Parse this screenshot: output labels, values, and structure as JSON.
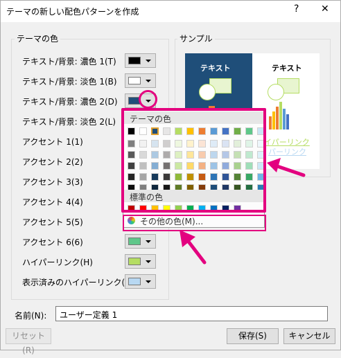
{
  "window": {
    "title": "テーマの新しい配色パターンを作成",
    "help_label": "?",
    "close_label": "✕"
  },
  "theme_colors": {
    "group_label": "テーマの色",
    "rows": [
      {
        "label": "テキスト/背景: 濃色 1(T)",
        "swatch": "#000000"
      },
      {
        "label": "テキスト/背景: 淡色 1(B)",
        "swatch": "#ffffff"
      },
      {
        "label": "テキスト/背景: 濃色 2(D)",
        "swatch": "#1f4e79"
      },
      {
        "label": "テキスト/背景: 淡色 2(L)",
        "swatch": ""
      },
      {
        "label": "アクセント 1(1)",
        "swatch": ""
      },
      {
        "label": "アクセント 2(2)",
        "swatch": ""
      },
      {
        "label": "アクセント 3(3)",
        "swatch": ""
      },
      {
        "label": "アクセント 4(4)",
        "swatch": ""
      },
      {
        "label": "アクセント 5(5)",
        "swatch": ""
      },
      {
        "label": "アクセント 6(6)",
        "swatch": "#5fc78a"
      },
      {
        "label": "ハイパーリンク(H)",
        "swatch": "#b5dd63"
      },
      {
        "label": "表示済みのハイパーリンク(F)",
        "swatch": "#b8d8f2"
      }
    ]
  },
  "sample": {
    "group_label": "サンプル",
    "dark_text": "テキスト",
    "light_text": "テキスト",
    "link1": "イパーリンク",
    "link2": "パーリンク",
    "colors": {
      "dark_bg": "#1f4e79",
      "light_bg": "#ffffff"
    }
  },
  "color_popup": {
    "theme_header": "テーマの色",
    "standard_header": "標準の色",
    "more_colors": "その他の色(M)...",
    "theme_top": [
      "#000000",
      "#ffffff",
      "#1f4e79",
      "#e7e6e6",
      "#b5dd63",
      "#ffc000",
      "#ed7d31",
      "#5b9bd5",
      "#4472c4",
      "#70ad47",
      "#5fc78a",
      "#c8e6f5"
    ],
    "theme_shades": [
      [
        "#7f7f7f",
        "#f2f2f2",
        "#d6e4f0",
        "#d0cece",
        "#eef7df",
        "#fff2cc",
        "#fbe4d5",
        "#deebf7",
        "#dae3f3",
        "#e2efda",
        "#dff4e7",
        "#eef7fc"
      ],
      [
        "#595959",
        "#d9d9d9",
        "#adc9e2",
        "#aeabab",
        "#ddf0c1",
        "#ffe699",
        "#f8cbad",
        "#bdd7ee",
        "#b4c7e7",
        "#c5e0b4",
        "#bfe9cf",
        "#ddf0fa"
      ],
      [
        "#404040",
        "#bfbfbf",
        "#84add3",
        "#757171",
        "#cbe8a2",
        "#ffd966",
        "#f4b183",
        "#9dc3e6",
        "#8faadc",
        "#a9d18e",
        "#9fdeb8",
        "#cce8f7"
      ],
      [
        "#262626",
        "#a6a6a6",
        "#173a5b",
        "#3a3838",
        "#8fb93a",
        "#bf9000",
        "#c55a11",
        "#2e75b6",
        "#2f5597",
        "#548235",
        "#38a865",
        "#6fb6e4"
      ],
      [
        "#0d0d0d",
        "#808080",
        "#0f273c",
        "#171616",
        "#5f7b27",
        "#806000",
        "#843c0c",
        "#1f4e79",
        "#203864",
        "#375623",
        "#256f43",
        "#2b7cb3"
      ]
    ],
    "standard": [
      "#c00000",
      "#ff0000",
      "#ffc000",
      "#ffff00",
      "#92d050",
      "#00b050",
      "#00b0f0",
      "#0070c0",
      "#002060",
      "#7030a0"
    ]
  },
  "footer": {
    "name_label": "名前(N):",
    "name_value": "ユーザー定義 1",
    "reset_label": "リセット(R)",
    "save_label": "保存(S)",
    "cancel_label": "キャンセル"
  },
  "annotation_color": "#e3007f"
}
